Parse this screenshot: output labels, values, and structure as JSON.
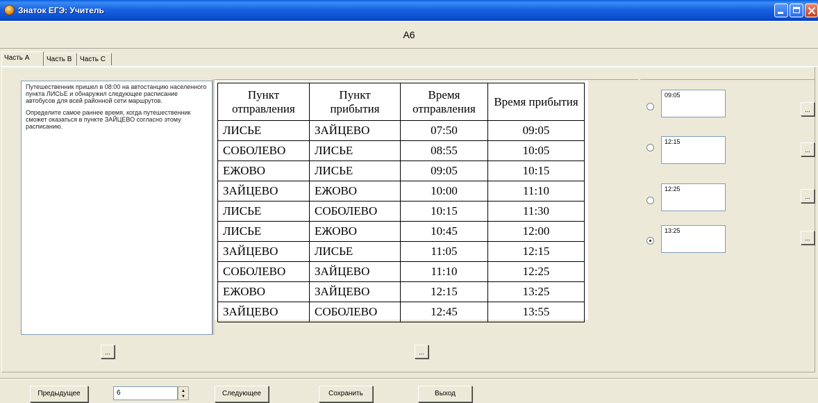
{
  "window": {
    "title": "Знаток ЕГЭ: Учитель"
  },
  "question": {
    "id": "А6"
  },
  "tabs": [
    {
      "label": "Часть А",
      "active": true
    },
    {
      "label": "Часть В",
      "active": false
    },
    {
      "label": "Часть С",
      "active": false
    }
  ],
  "problem": {
    "paragraph1": "Путешественник пришел в 08:00 на автостанцию населенного пункта ЛИСЬЕ и обнаружил следующее расписание автобусов для всей районной сети маршрутов.",
    "paragraph2": "Определите самое раннее время, когда путешественник сможет оказаться в пункте ЗАЙЦЕВО согласно этому расписанию."
  },
  "schedule": {
    "headers": [
      "Пункт отправления",
      "Пункт прибытия",
      "Время отправления",
      "Время прибытия"
    ],
    "rows": [
      [
        "ЛИСЬЕ",
        "ЗАЙЦЕВО",
        "07:50",
        "09:05"
      ],
      [
        "СОБОЛЕВО",
        "ЛИСЬЕ",
        "08:55",
        "10:05"
      ],
      [
        "ЕЖОВО",
        "ЛИСЬЕ",
        "09:05",
        "10:15"
      ],
      [
        "ЗАЙЦЕВО",
        "ЕЖОВО",
        "10:00",
        "11:10"
      ],
      [
        "ЛИСЬЕ",
        "СОБОЛЕВО",
        "10:15",
        "11:30"
      ],
      [
        "ЛИСЬЕ",
        "ЕЖОВО",
        "10:45",
        "12:00"
      ],
      [
        "ЗАЙЦЕВО",
        "ЛИСЬЕ",
        "11:05",
        "12:15"
      ],
      [
        "СОБОЛЕВО",
        "ЗАЙЦЕВО",
        "11:10",
        "12:25"
      ],
      [
        "ЕЖОВО",
        "ЗАЙЦЕВО",
        "12:15",
        "13:25"
      ],
      [
        "ЗАЙЦЕВО",
        "СОБОЛЕВО",
        "12:45",
        "13:55"
      ]
    ]
  },
  "answers": [
    {
      "text": "09:05",
      "selected": false
    },
    {
      "text": "12:15",
      "selected": false
    },
    {
      "text": "12:25",
      "selected": false
    },
    {
      "text": "13:25",
      "selected": true
    }
  ],
  "ellipsis": "...",
  "footer": {
    "prev_label": "Предыдущее",
    "question_number": "6",
    "next_label": "Следующее",
    "save_label": "Сохранить",
    "exit_label": "Выход"
  },
  "colors": {
    "titlebar": "#0a4fd1",
    "window_bg": "#ece9d8"
  }
}
